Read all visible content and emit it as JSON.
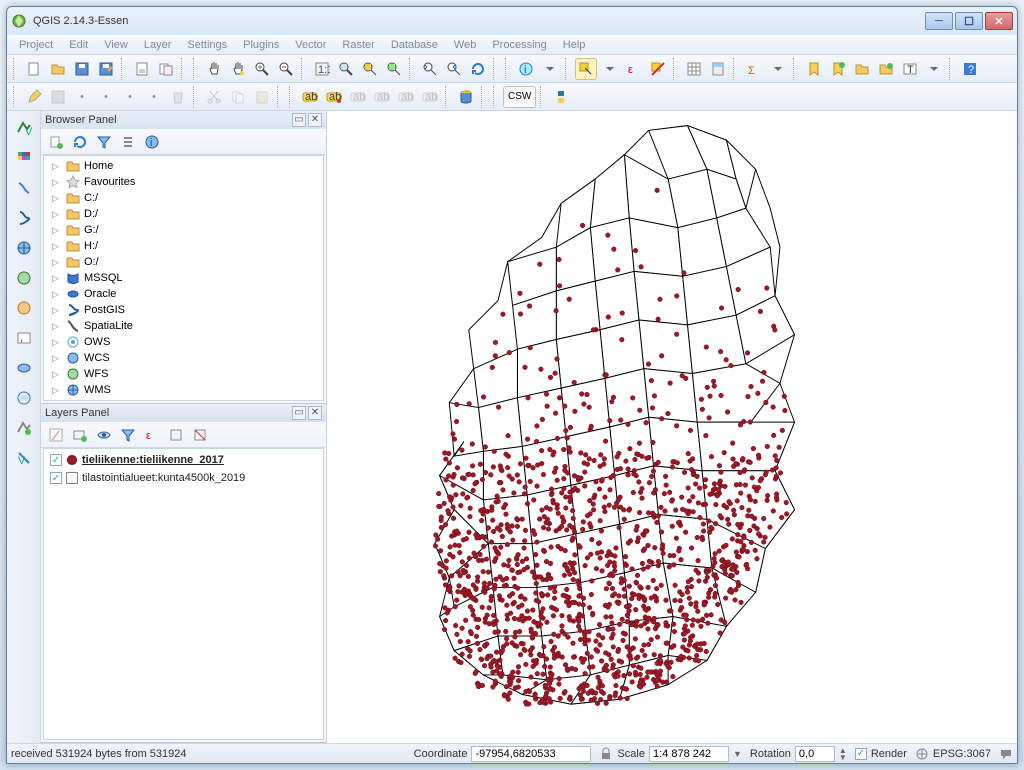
{
  "window": {
    "title": "QGIS 2.14.3-Essen"
  },
  "menus": [
    "Project",
    "Edit",
    "View",
    "Layer",
    "Settings",
    "Plugins",
    "Vector",
    "Raster",
    "Database",
    "Web",
    "Processing",
    "Help"
  ],
  "panels": {
    "browser": {
      "title": "Browser Panel",
      "items": [
        {
          "icon": "folder",
          "label": "Home"
        },
        {
          "icon": "star",
          "label": "Favourites"
        },
        {
          "icon": "folder",
          "label": "C:/"
        },
        {
          "icon": "folder",
          "label": "D:/"
        },
        {
          "icon": "folder",
          "label": "G:/"
        },
        {
          "icon": "folder",
          "label": "H:/"
        },
        {
          "icon": "folder",
          "label": "O:/"
        },
        {
          "icon": "mssql",
          "label": "MSSQL"
        },
        {
          "icon": "oracle",
          "label": "Oracle"
        },
        {
          "icon": "postgis",
          "label": "PostGIS"
        },
        {
          "icon": "spatialite",
          "label": "SpatiaLite"
        },
        {
          "icon": "ows",
          "label": "OWS"
        },
        {
          "icon": "wcs",
          "label": "WCS"
        },
        {
          "icon": "wfs",
          "label": "WFS"
        },
        {
          "icon": "wms",
          "label": "WMS"
        }
      ]
    },
    "layers": {
      "title": "Layers Panel",
      "items": [
        {
          "checked": true,
          "symbol": "point",
          "name": "tieliikenne:tieliikenne_2017",
          "active": true
        },
        {
          "checked": true,
          "symbol": "poly",
          "name": "tilastointialueet:kunta4500k_2019",
          "active": false
        }
      ]
    }
  },
  "status": {
    "message": "received 531924 bytes from 531924",
    "coord_label": "Coordinate",
    "coord_value": "-97954,6820533",
    "scale_label": "Scale",
    "scale_value": "1:4 878 242",
    "rotation_label": "Rotation",
    "rotation_value": "0,0",
    "render_label": "Render",
    "crs": "EPSG:3067"
  },
  "labels": {
    "csw": "CSW"
  }
}
